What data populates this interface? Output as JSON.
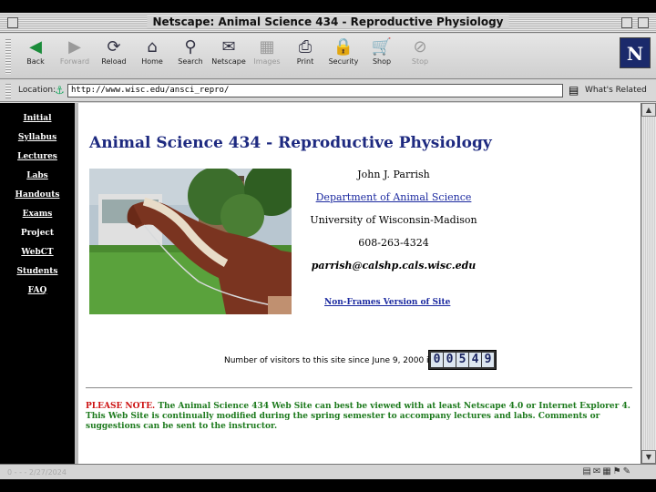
{
  "window": {
    "title": "Netscape: Animal Science 434 - Reproductive Physiology"
  },
  "toolbar": {
    "buttons": [
      {
        "label": "Back",
        "icon": "back-arrow-icon",
        "enabled": true
      },
      {
        "label": "Forward",
        "icon": "forward-arrow-icon",
        "enabled": false
      },
      {
        "label": "Reload",
        "icon": "reload-icon",
        "enabled": true
      },
      {
        "label": "Home",
        "icon": "home-icon",
        "enabled": true
      },
      {
        "label": "Search",
        "icon": "search-icon",
        "enabled": true
      },
      {
        "label": "Netscape",
        "icon": "netscape-icon",
        "enabled": true
      },
      {
        "label": "Images",
        "icon": "images-icon",
        "enabled": false
      },
      {
        "label": "Print",
        "icon": "print-icon",
        "enabled": true
      },
      {
        "label": "Security",
        "icon": "security-lock-icon",
        "enabled": true
      },
      {
        "label": "Shop",
        "icon": "shop-icon",
        "enabled": true
      },
      {
        "label": "Stop",
        "icon": "stop-icon",
        "enabled": false
      }
    ],
    "logo_letter": "N"
  },
  "location": {
    "label": "Location:",
    "url": "http://www.wisc.edu/ansci_repro/",
    "related_label": "What's Related"
  },
  "nav": {
    "items": [
      {
        "label": "Initial",
        "underlined": true
      },
      {
        "label": "Syllabus",
        "underlined": true
      },
      {
        "label": "Lectures",
        "underlined": true
      },
      {
        "label": "Labs",
        "underlined": true
      },
      {
        "label": "Handouts",
        "underlined": true
      },
      {
        "label": "Exams",
        "underlined": true
      },
      {
        "label": "Project",
        "underlined": false
      },
      {
        "label": "WebCT",
        "underlined": true
      },
      {
        "label": "Students",
        "underlined": true
      },
      {
        "label": "FAQ",
        "underlined": true
      }
    ]
  },
  "page": {
    "title": "Animal Science 434 - Reproductive Physiology",
    "instructor": "John J. Parrish",
    "department": "Department of Animal Science",
    "university": "University of Wisconsin-Madison",
    "phone": "608-263-4324",
    "email": "parrish@calshp.cals.wisc.edu",
    "nonframes_link": "Non-Frames Version of Site",
    "visitors_text": "Number of visitors to this site since June 9, 2000 is:",
    "counter_digits": [
      "0",
      "0",
      "5",
      "4",
      "9"
    ],
    "note_label": "PLEASE NOTE.",
    "note_text": " The Animal Science 434 Web Site can best be viewed with at least Netscape 4.0 or Internet Explorer 4. This Web Site is continually modified during the spring semester to accompany lectures and labs. Comments or suggestions can be sent to the instructor."
  },
  "footer": {
    "text": "0 -  - - 2/27/2024"
  },
  "colors": {
    "title_blue": "#1e2a80",
    "link_blue": "#1c2aa0",
    "note_green": "#1d7a1d",
    "note_red": "#cc1111"
  }
}
